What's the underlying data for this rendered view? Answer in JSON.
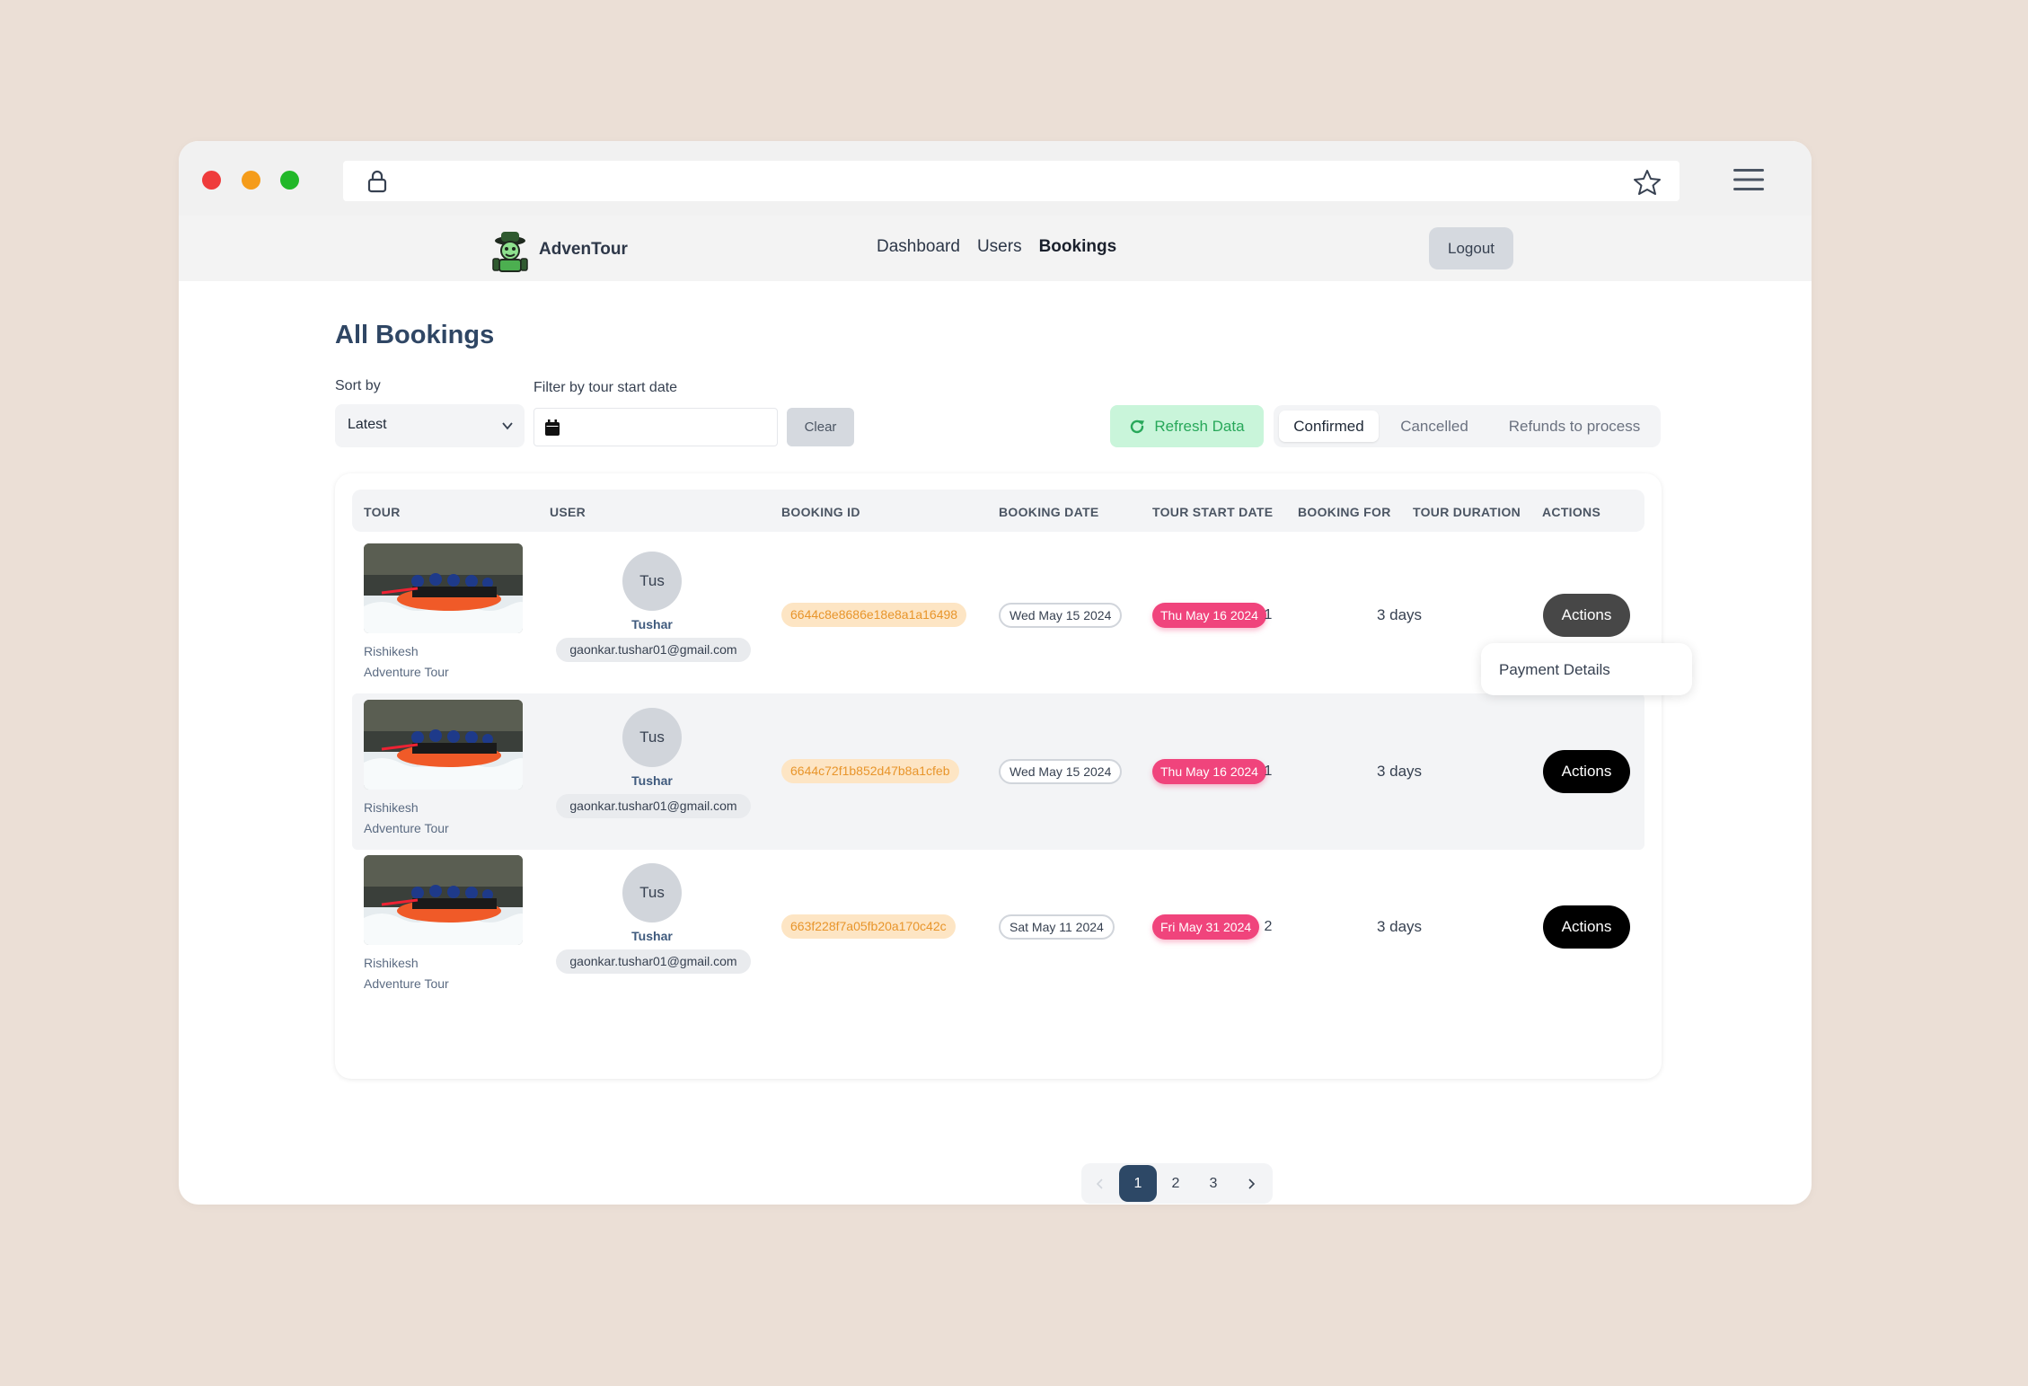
{
  "app": {
    "name": "AdvenTour"
  },
  "nav": {
    "links": [
      "Dashboard",
      "Users",
      "Bookings"
    ],
    "active": "Bookings",
    "logout": "Logout"
  },
  "page": {
    "title": "All Bookings"
  },
  "filters": {
    "sort_label": "Sort by",
    "sort_value": "Latest",
    "date_label": "Filter by tour start date",
    "clear": "Clear"
  },
  "controls": {
    "refresh": "Refresh Data",
    "tabs": [
      "Confirmed",
      "Cancelled",
      "Refunds to process"
    ],
    "active_tab": "Confirmed"
  },
  "table": {
    "headers": [
      "TOUR",
      "USER",
      "BOOKING ID",
      "BOOKING DATE",
      "TOUR START DATE",
      "BOOKING FOR",
      "TOUR DURATION",
      "ACTIONS"
    ],
    "rows": [
      {
        "tour_line1": "Rishikesh",
        "tour_line2": "Adventure Tour",
        "avatar": "Tus",
        "user": "Tushar",
        "email": "gaonkar.tushar01@gmail.com",
        "booking_id": "6644c8e8686e18e8a1a16498",
        "booking_date": "Wed May 15 2024",
        "start_date": "Thu May 16 2024",
        "booking_for": "1",
        "duration": "3 days",
        "action": "Actions"
      },
      {
        "tour_line1": "Rishikesh",
        "tour_line2": "Adventure Tour",
        "avatar": "Tus",
        "user": "Tushar",
        "email": "gaonkar.tushar01@gmail.com",
        "booking_id": "6644c72f1b852d47b8a1cfeb",
        "booking_date": "Wed May 15 2024",
        "start_date": "Thu May 16 2024",
        "booking_for": "1",
        "duration": "3 days",
        "action": "Actions"
      },
      {
        "tour_line1": "Rishikesh",
        "tour_line2": "Adventure Tour",
        "avatar": "Tus",
        "user": "Tushar",
        "email": "gaonkar.tushar01@gmail.com",
        "booking_id": "663f228f7a05fb20a170c42c",
        "booking_date": "Sat May 11 2024",
        "start_date": "Fri May 31 2024",
        "booking_for": "2",
        "duration": "3 days",
        "action": "Actions"
      }
    ]
  },
  "dropdown": {
    "item": "Payment Details"
  },
  "pagination": {
    "pages": [
      "1",
      "2",
      "3"
    ],
    "current": "1"
  },
  "colors": {
    "accent": "#2d4866",
    "start_date_badge": "#f0447c",
    "booking_id_badge": "#fde5c4",
    "refresh": "#28a85a"
  }
}
